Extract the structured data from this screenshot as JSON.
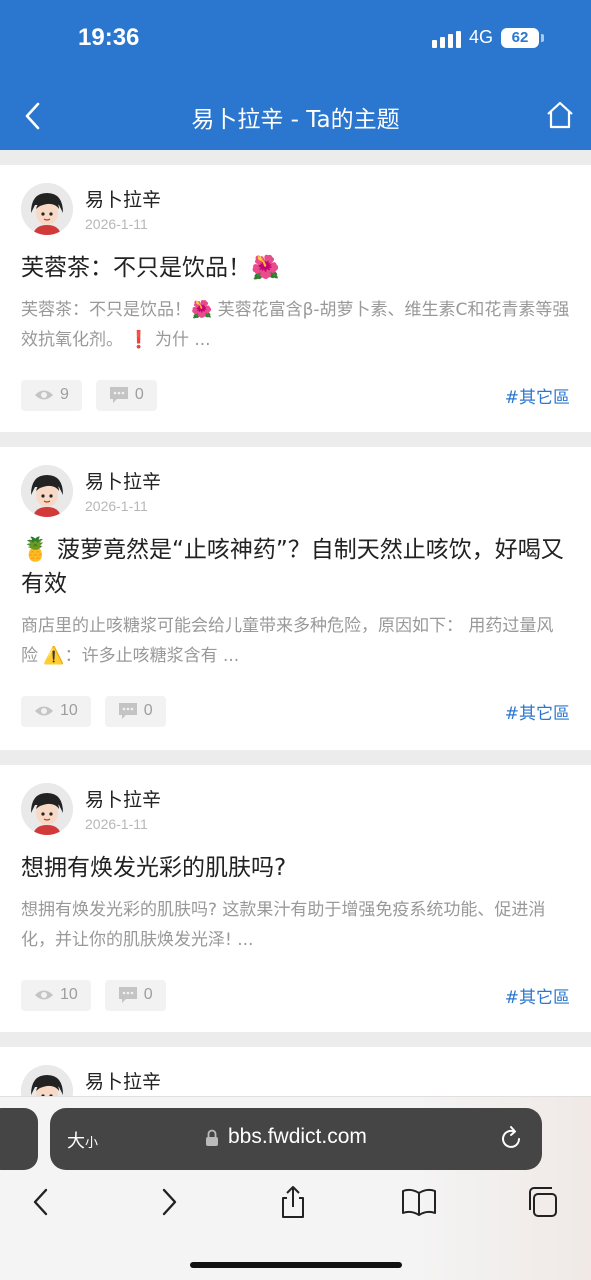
{
  "status": {
    "time": "19:36",
    "network": "4G",
    "battery": "62"
  },
  "header": {
    "title": "易卜拉辛 - Ta的主题"
  },
  "posts": [
    {
      "author": "易卜拉辛",
      "date": "2026-1-11",
      "title": "芙蓉茶：不只是饮品！🌺",
      "excerpt": "芙蓉茶：不只是饮品！🌺 芙蓉花富含β-胡萝卜素、维生素C和花青素等强效抗氧化剂。 ❗ 为什 ...",
      "views": "9",
      "comments": "0",
      "tag": "#其它區"
    },
    {
      "author": "易卜拉辛",
      "date": "2026-1-11",
      "title": "🍍 菠萝竟然是“止咳神药”？自制天然止咳饮，好喝又有效",
      "excerpt": "商店里的止咳糖浆可能会给儿童带来多种危险，原因如下： 用药过量风险 ⚠️：许多止咳糖浆含有 ...",
      "views": "10",
      "comments": "0",
      "tag": "#其它區"
    },
    {
      "author": "易卜拉辛",
      "date": "2026-1-11",
      "title": "想拥有焕发光彩的肌肤吗?",
      "excerpt": "想拥有焕发光彩的肌肤吗? 这款果汁有助于增强免疫系统功能、促进消化，并让你的肌肤焕发光泽! ...",
      "views": "10",
      "comments": "0",
      "tag": "#其它區"
    },
    {
      "author": "易卜拉辛"
    }
  ],
  "browser": {
    "size_label": "大",
    "size_label_small": "小",
    "url": "bbs.fwdict.com"
  },
  "colors": {
    "brand": "#2b77cf",
    "muted": "#999999",
    "background": "#ececec"
  }
}
